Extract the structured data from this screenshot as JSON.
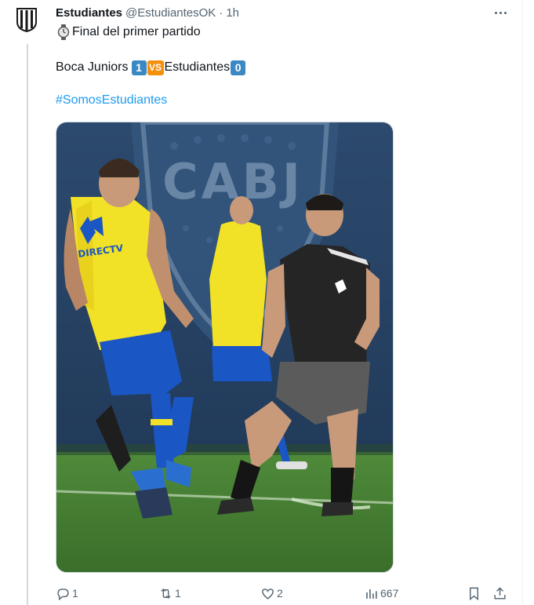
{
  "tweet": {
    "author_name": "Estudiantes",
    "handle": "@EstudiantesOK",
    "separator": "·",
    "time": "1h",
    "line1_text": "Final del primer partido",
    "team_home": "Boca Juniors",
    "score_home": "1",
    "vs_label": "VS",
    "team_away": "Estudiantes",
    "score_away": "0",
    "hashtag": "#SomosEstudiantes",
    "photo_sign_text": "CABJ",
    "photo_sponsor_text": "DIRECTV"
  },
  "actions": {
    "replies": "1",
    "reposts": "1",
    "likes": "2",
    "views": "667"
  },
  "icons": {
    "avatar": "estudiantes-crest-icon",
    "emoji": "stopwatch-icon",
    "more": "more-icon",
    "reply": "reply-icon",
    "repost": "repost-icon",
    "like": "heart-icon",
    "views": "views-icon",
    "bookmark": "bookmark-icon",
    "share": "share-icon"
  },
  "colors": {
    "link": "#1d9bf0",
    "score_badge": "#3b88c3",
    "vs_badge": "#f4900c",
    "muted": "#536471",
    "boca_yellow": "#f2e227",
    "boca_blue": "#1a56c4"
  }
}
